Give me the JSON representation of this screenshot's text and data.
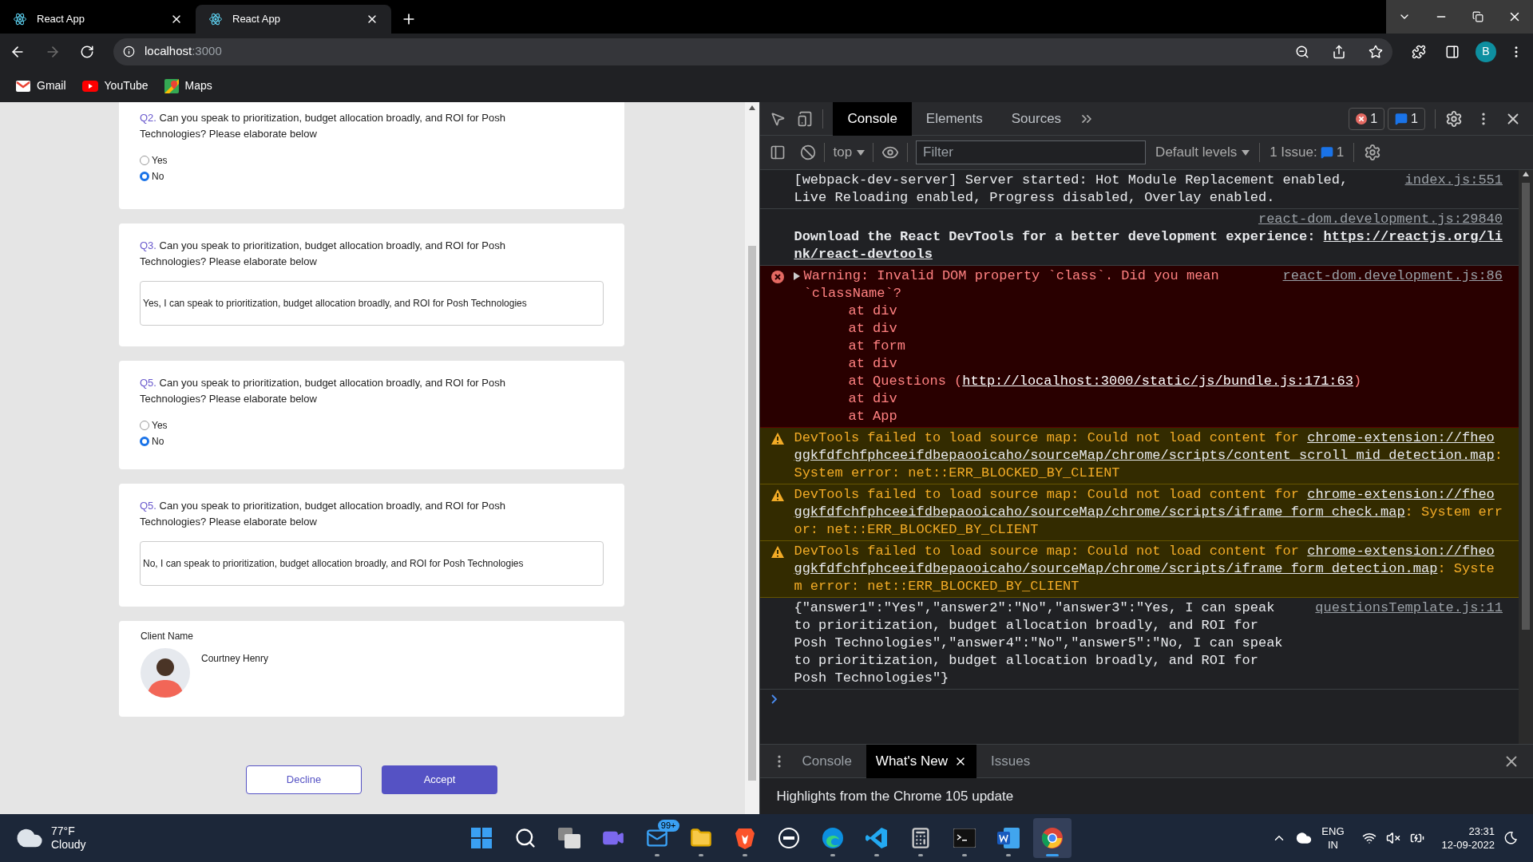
{
  "browser": {
    "tabs": [
      {
        "title": "React App",
        "selected": false
      },
      {
        "title": "React App",
        "selected": true
      }
    ],
    "address": {
      "host": "localhost",
      "port": ":3000"
    },
    "profile": "B",
    "bookmarks": [
      {
        "label": "Gmail",
        "kind": "gmail"
      },
      {
        "label": "YouTube",
        "kind": "youtube"
      },
      {
        "label": "Maps",
        "kind": "maps"
      }
    ]
  },
  "page": {
    "questions": [
      {
        "number": "Q2.",
        "text": "Can you speak to prioritization, budget allocation broadly, and ROI for Posh Technologies? Please elaborate below",
        "kind": "radio",
        "options": [
          {
            "label": "Yes",
            "selected": false
          },
          {
            "label": "No",
            "selected": true
          }
        ]
      },
      {
        "number": "Q3.",
        "text": "Can you speak to prioritization, budget allocation broadly, and ROI for Posh Technologies? Please elaborate below",
        "kind": "text",
        "value": "Yes, I can speak to prioritization, budget allocation broadly, and ROI for Posh Technologies"
      },
      {
        "number": "Q5.",
        "text": "Can you speak to prioritization, budget allocation broadly, and ROI for Posh Technologies? Please elaborate below",
        "kind": "radio",
        "options": [
          {
            "label": "Yes",
            "selected": false
          },
          {
            "label": "No",
            "selected": true
          }
        ]
      },
      {
        "number": "Q5.",
        "text": "Can you speak to prioritization, budget allocation broadly, and ROI for Posh Technologies? Please elaborate below",
        "kind": "text",
        "value": "No, I can speak to prioritization, budget allocation broadly, and ROI for Posh Technologies"
      }
    ],
    "client": {
      "label": "Client Name",
      "name": "Courtney Henry"
    },
    "buttons": [
      {
        "label": "Decline",
        "kind": "secondary"
      },
      {
        "label": "Accept",
        "kind": "primary"
      }
    ]
  },
  "devtools": {
    "tabs": [
      {
        "label": "Console",
        "selected": true
      },
      {
        "label": "Elements",
        "selected": false
      },
      {
        "label": "Sources",
        "selected": false
      }
    ],
    "error_count": "1",
    "message_count": "1",
    "context": "top",
    "filter_placeholder": "Filter",
    "levels": "Default levels",
    "issues_label": "1 Issue:",
    "issues_count": "1",
    "messages": [
      {
        "kind": "log",
        "source": "index.js:551",
        "segments": [
          {
            "text": "[webpack-dev-server] Server started: Hot Module Replacement enabled, Live Reloading enabled, Progress disabled, Overlay enabled.",
            "link": false
          }
        ]
      },
      {
        "kind": "banner",
        "source": "react-dom.development.js:29840",
        "segments": [
          {
            "text": "Download the React DevTools for a better development experience: ",
            "link": false
          },
          {
            "text": "https://reactjs.org/link/react-devtools",
            "link": true
          }
        ]
      },
      {
        "kind": "error",
        "source": "react-dom.development.js:86",
        "segments": [
          {
            "text": "Warning: Invalid DOM property `class`. Did you mean `className`?",
            "link": false
          }
        ],
        "stack": [
          [
            {
              "text": "at div",
              "link": false
            }
          ],
          [
            {
              "text": "at div",
              "link": false
            }
          ],
          [
            {
              "text": "at form",
              "link": false
            }
          ],
          [
            {
              "text": "at div",
              "link": false
            }
          ],
          [
            {
              "text": "at Questions (",
              "link": false
            },
            {
              "text": "http://localhost:3000/static/js/bundle.js:171:63",
              "link": true
            },
            {
              "text": ")",
              "link": false
            }
          ],
          [
            {
              "text": "at div",
              "link": false
            }
          ],
          [
            {
              "text": "at App",
              "link": false
            }
          ]
        ]
      },
      {
        "kind": "warning",
        "segments": [
          {
            "text": "DevTools failed to load source map: Could not load content for ",
            "link": false
          },
          {
            "text": "chrome-extension://fheoggkfdfchfphceeifdbepaooicaho/sourceMap/chrome/scripts/content_scroll_mid_detection.map",
            "link": true
          },
          {
            "text": ": System error: net::ERR_BLOCKED_BY_CLIENT",
            "link": false
          }
        ]
      },
      {
        "kind": "warning",
        "segments": [
          {
            "text": "DevTools failed to load source map: Could not load content for ",
            "link": false
          },
          {
            "text": "chrome-extension://fheoggkfdfchfphceeifdbepaooicaho/sourceMap/chrome/scripts/iframe_form_check.map",
            "link": true
          },
          {
            "text": ": System error: net::ERR_BLOCKED_BY_CLIENT",
            "link": false
          }
        ]
      },
      {
        "kind": "warning",
        "segments": [
          {
            "text": "DevTools failed to load source map: Could not load content for ",
            "link": false
          },
          {
            "text": "chrome-extension://fheoggkfdfchfphceeifdbepaooicaho/sourceMap/chrome/scripts/iframe_form_detection.map",
            "link": true
          },
          {
            "text": ": System error: net::ERR_BLOCKED_BY_CLIENT",
            "link": false
          }
        ]
      },
      {
        "kind": "log",
        "source": "questionsTemplate.js:11",
        "segments": [
          {
            "text": "{\"answer1\":\"Yes\",\"answer2\":\"No\",\"answer3\":\"Yes, I can speak to prioritization, budget allocation broadly, and ROI for Posh Technologies\",\"answer4\":\"No\",\"answer5\":\"No, I can speak to prioritization, budget allocation broadly, and ROI for Posh Technologies\"}",
            "link": false
          }
        ]
      }
    ],
    "drawer": {
      "tabs": [
        {
          "label": "Console",
          "selected": false
        },
        {
          "label": "What's New",
          "selected": true
        },
        {
          "label": "Issues",
          "selected": false
        }
      ],
      "content": "Highlights from the Chrome 105 update"
    }
  },
  "taskbar": {
    "weather": {
      "temperature": "77°F",
      "condition": "Cloudy"
    },
    "apps": [
      {
        "kind": "start",
        "running": false,
        "active": false
      },
      {
        "kind": "search",
        "running": false,
        "active": false
      },
      {
        "kind": "taskview",
        "running": false,
        "active": false
      },
      {
        "kind": "chat",
        "running": false,
        "active": false
      },
      {
        "kind": "mail",
        "running": true,
        "active": false,
        "badge": "99+"
      },
      {
        "kind": "files",
        "running": true,
        "active": false
      },
      {
        "kind": "brave",
        "running": true,
        "active": false
      },
      {
        "kind": "dell",
        "running": false,
        "active": false
      },
      {
        "kind": "edge",
        "running": true,
        "active": false
      },
      {
        "kind": "vscode",
        "running": true,
        "active": false
      },
      {
        "kind": "calculator",
        "running": true,
        "active": false
      },
      {
        "kind": "terminal",
        "running": true,
        "active": false
      },
      {
        "kind": "word",
        "running": true,
        "active": false
      },
      {
        "kind": "chrome",
        "running": true,
        "active": true
      }
    ],
    "language": "ENG",
    "region": "IN",
    "time": "23:31",
    "date": "12-09-2022"
  }
}
